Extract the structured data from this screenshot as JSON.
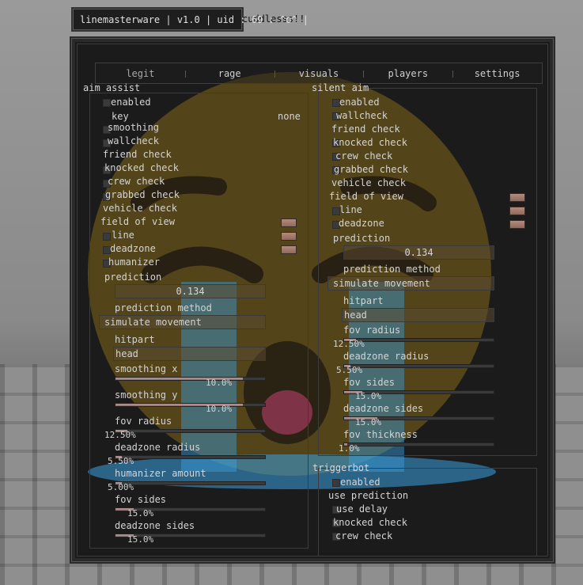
{
  "watermark": {
    "label": "linemasterware | v1.0 | uid : 69 : ^o^ |",
    "suffix": "cuddlesss!!"
  },
  "tabs": [
    "legit",
    "rage",
    "visuals",
    "players",
    "settings"
  ],
  "aim_assist": {
    "title": "aim assist",
    "enabled": "enabled",
    "key_label": "key",
    "key_value": "none",
    "smoothing": "smoothing",
    "wallcheck": "wallcheck",
    "friend_check": "friend check",
    "knocked_check": "knocked check",
    "crew_check": "crew check",
    "grabbed_check": "grabbed check",
    "vehicle_check": "vehicle check",
    "field_of_view": "field of view",
    "line": "line",
    "deadzone": "deadzone",
    "humanizer": "humanizer",
    "prediction": "prediction",
    "prediction_value": "0.134",
    "prediction_method": "prediction method",
    "prediction_method_value": "simulate movement",
    "hitpart": "hitpart",
    "hitpart_value": "head",
    "smoothing_x": "smoothing x",
    "smoothing_x_value": "10.0%",
    "smoothing_x_fill": 0.85,
    "smoothing_y": "smoothing y",
    "smoothing_y_value": "10.0%",
    "smoothing_y_fill": 0.85,
    "fov_radius": "fov radius",
    "fov_radius_value": "12.50%",
    "fov_radius_fill": 0.08,
    "deadzone_radius": "deadzone radius",
    "deadzone_radius_value": "5.50%",
    "deadzone_radius_fill": 0.04,
    "humanizer_amount": "humanizer amount",
    "humanizer_amount_value": "5.00%",
    "humanizer_amount_fill": 0.04,
    "fov_sides": "fov sides",
    "fov_sides_value": "15.0%",
    "fov_sides_fill": 0.12,
    "deadzone_sides": "deadzone sides",
    "deadzone_sides_value": "15.0%",
    "deadzone_sides_fill": 0.12
  },
  "silent_aim": {
    "title": "silent aim",
    "enabled": "enabled",
    "wallcheck": "wallcheck",
    "friend_check": "friend check",
    "knocked_check": "knocked check",
    "crew_check": "crew check",
    "grabbed_check": "grabbed check",
    "vehicle_check": "vehicle check",
    "field_of_view": "field of view",
    "line": "line",
    "deadzone": "deadzone",
    "prediction": "prediction",
    "prediction_value": "0.134",
    "prediction_method": "prediction method",
    "prediction_method_value": "simulate movement",
    "hitpart": "hitpart",
    "hitpart_value": "head",
    "fov_radius": "fov radius",
    "fov_radius_value": "12.50%",
    "fov_radius_fill": 0.08,
    "deadzone_radius": "deadzone radius",
    "deadzone_radius_value": "5.50%",
    "deadzone_radius_fill": 0.04,
    "fov_sides": "fov sides",
    "fov_sides_value": "15.0%",
    "fov_sides_fill": 0.12,
    "deadzone_sides": "deadzone sides",
    "deadzone_sides_value": "15.0%",
    "deadzone_sides_fill": 0.22,
    "fov_thickness": "fov thickness",
    "fov_thickness_value": "1.0%",
    "fov_thickness_fill": 0.02
  },
  "triggerbot": {
    "title": "triggerbot",
    "enabled": "enabled",
    "use_prediction": "use prediction",
    "use_delay": "use delay",
    "knocked_check": "knocked check",
    "crew_check": "crew check"
  },
  "colors": {
    "swatch": "#a47c6e",
    "slider_fill": "#a88888",
    "emoji_face": "#d7a41a",
    "emoji_tear": "#3aa0e0"
  }
}
